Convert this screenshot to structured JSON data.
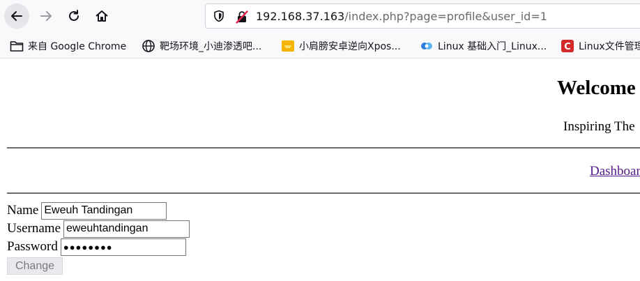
{
  "browser": {
    "url_host": "192.168.37.163",
    "url_path": "/index.php?page=profile&user_id=1"
  },
  "bookmarks": [
    {
      "label": "来自 Google Chrome",
      "icon": "folder-icon"
    },
    {
      "label": "靶场环境_小迪渗透吧...",
      "icon": "globe-icon"
    },
    {
      "label": "小肩膀安卓逆向Xpos...",
      "icon": "yellow-card-icon"
    },
    {
      "label": "Linux 基础入门_Linux...",
      "icon": "cloud-icon"
    },
    {
      "label": "Linux文件管理",
      "icon": "red-c-icon"
    }
  ],
  "page": {
    "welcome": "Welcome",
    "tagline": "Inspiring The",
    "nav_link": "Dashboar"
  },
  "form": {
    "name_label": "Name",
    "name_value": "Eweuh Tandingan",
    "username_label": "Username",
    "username_value": "eweuhtandingan",
    "password_label": "Password",
    "password_mask": "●●●●●●●●",
    "submit_label": "Change"
  }
}
